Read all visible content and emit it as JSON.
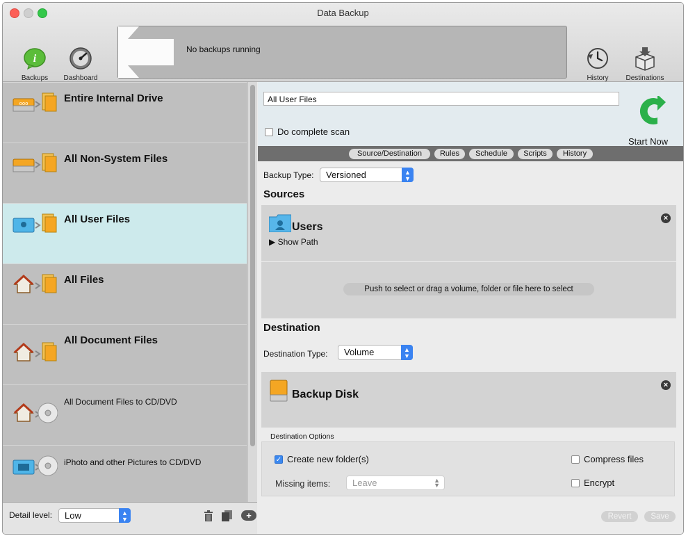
{
  "window": {
    "title": "Data Backup"
  },
  "toolbar": {
    "backups_label": "Backups",
    "dashboard_label": "Dashboard",
    "status_text": "No backups running",
    "history_label": "History",
    "destinations_label": "Destinations"
  },
  "sets": [
    {
      "name": "Entire Internal Drive",
      "icon": "drive-to-files-icon"
    },
    {
      "name": "All Non-System Files",
      "icon": "drive-to-files-icon"
    },
    {
      "name": "All User Files",
      "icon": "users-folder-to-files-icon",
      "selected": true
    },
    {
      "name": "All Files",
      "icon": "home-to-files-icon"
    },
    {
      "name": "All Document Files",
      "icon": "home-to-files-icon"
    },
    {
      "name": "All Document Files to CD/DVD",
      "icon": "home-to-disc-icon"
    },
    {
      "name": "iPhoto and other Pictures to CD/DVD",
      "icon": "photo-folder-to-disc-icon"
    }
  ],
  "bottom": {
    "detail_label": "Detail level:",
    "detail_value": "Low"
  },
  "editor": {
    "set_name": "All User Files",
    "complete_scan_label": "Do complete scan",
    "complete_scan_checked": false,
    "start_now_label": "Start Now",
    "tabs": [
      "Source/Destination",
      "Rules",
      "Schedule",
      "Scripts",
      "History"
    ],
    "active_tab": "Source/Destination",
    "backup_type_label": "Backup Type:",
    "backup_type_value": "Versioned",
    "sources_header": "Sources",
    "source_name": "Users",
    "show_path_label": "▶ Show Path",
    "push_select_label": "Push to select or drag a volume, folder or file here to select",
    "destination_header": "Destination",
    "destination_type_label": "Destination Type:",
    "destination_type_value": "Volume",
    "destination_name": "Backup Disk",
    "dest_options_label": "Destination Options",
    "create_folders_label": "Create new folder(s)",
    "create_folders_checked": true,
    "compress_label": "Compress files",
    "compress_checked": false,
    "missing_items_label": "Missing items:",
    "missing_items_value": "Leave",
    "encrypt_label": "Encrypt",
    "encrypt_checked": false,
    "revert_label": "Revert",
    "save_label": "Save"
  },
  "colors": {
    "accent": "#3a83f1",
    "start_green": "#2bb04a",
    "selected_row": "#cdeaec"
  }
}
